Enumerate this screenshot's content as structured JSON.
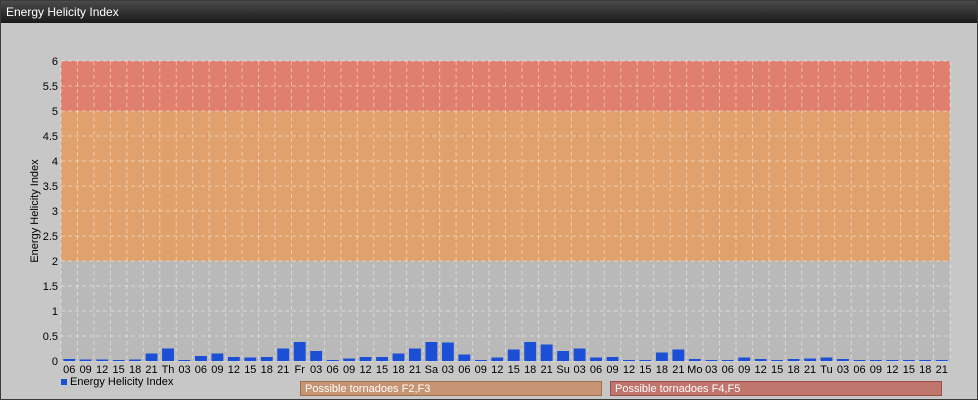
{
  "window": {
    "title": "Energy Helicity Index"
  },
  "legend": {
    "label": "Energy Helicity Index"
  },
  "zones": [
    {
      "label": "Possible tornadoes F2,F3"
    },
    {
      "label": "Possible tornadoes F4,F5"
    }
  ],
  "colors": {
    "bar": "#1a4fd6",
    "band_low": "#b9b9b9",
    "band_mid": "#e0a16c",
    "band_high": "#e17f6e"
  },
  "chart_data": {
    "type": "bar",
    "ylabel": "Energy Helicity Index",
    "ylim": [
      0,
      6
    ],
    "yticks": [
      "0",
      "0.5",
      "1",
      "1.5",
      "2",
      "2.5",
      "3",
      "3.5",
      "4",
      "4.5",
      "5",
      "5.5",
      "6"
    ],
    "bands": [
      {
        "from": 0,
        "to": 2
      },
      {
        "from": 2,
        "to": 5
      },
      {
        "from": 5,
        "to": 6
      }
    ],
    "categories": [
      "06",
      "09",
      "12",
      "15",
      "18",
      "21",
      "Th",
      "03",
      "06",
      "09",
      "12",
      "15",
      "18",
      "21",
      "Fr",
      "03",
      "06",
      "09",
      "12",
      "15",
      "18",
      "21",
      "Sa",
      "03",
      "06",
      "09",
      "12",
      "15",
      "18",
      "21",
      "Su",
      "03",
      "06",
      "09",
      "12",
      "15",
      "18",
      "21",
      "Mo",
      "03",
      "06",
      "09",
      "12",
      "15",
      "18",
      "21",
      "Tu",
      "03",
      "06",
      "09",
      "12",
      "15",
      "18",
      "21"
    ],
    "values": [
      0.04,
      0.03,
      0.03,
      0.02,
      0.03,
      0.15,
      0.25,
      0.02,
      0.1,
      0.15,
      0.08,
      0.07,
      0.08,
      0.25,
      0.38,
      0.2,
      0.02,
      0.05,
      0.08,
      0.08,
      0.15,
      0.25,
      0.38,
      0.37,
      0.13,
      0.02,
      0.07,
      0.23,
      0.38,
      0.33,
      0.2,
      0.25,
      0.07,
      0.08,
      0.02,
      0.02,
      0.17,
      0.23,
      0.04,
      0.02,
      0.02,
      0.07,
      0.04,
      0.02,
      0.04,
      0.05,
      0.07,
      0.04,
      0.02,
      0.02,
      0.02,
      0.02,
      0.02,
      0.02
    ]
  }
}
